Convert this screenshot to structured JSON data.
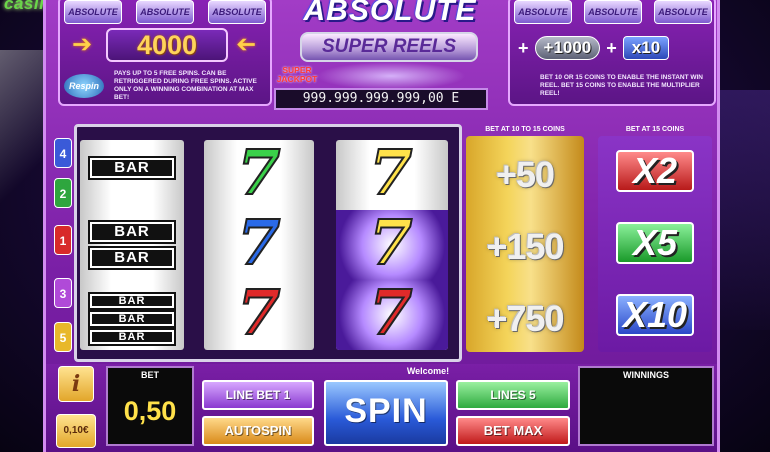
{
  "brand": {
    "text": "casino"
  },
  "top_left": {
    "mini_logos": [
      "ABSOLUTE",
      "ABSOLUTE",
      "ABSOLUTE"
    ],
    "jackpot_value": "4000",
    "respin_logo": "Respin",
    "description": "PAYS UP TO 5 FREE SPINS. CAN BE RETRIGGERED DURING FREE SPINS. ACTIVE ONLY ON A WINNING COMBINATION AT MAX BET!"
  },
  "logo": {
    "title": "ABSOLUTE",
    "subtitle": "SUPER REELS"
  },
  "super_jackpot": {
    "label": "SUPER JACKPOT",
    "value": "999.999.999.999,00 E"
  },
  "top_right": {
    "mini_logos": [
      "ABSOLUTE",
      "ABSOLUTE",
      "ABSOLUTE"
    ],
    "plus": "+",
    "bonus": "+1000",
    "multiplier": "x10",
    "description": "BET 10 OR 15 COINS TO ENABLE THE INSTANT WIN REEL. BET 15 COINS TO ENABLE THE MULTIPLIER REEL!"
  },
  "lines": [
    "4",
    "2",
    "1",
    "3",
    "5"
  ],
  "reels": {
    "reel1": {
      "bar1": "BAR",
      "bar2": "BAR",
      "bar3": "BAR",
      "bar4": "BAR",
      "bar5": "BAR",
      "bar6": "BAR"
    },
    "seven": "7"
  },
  "bonus_reel": {
    "header": "BET AT 10 TO 15 COINS",
    "values": [
      "+50",
      "+150",
      "+750"
    ]
  },
  "multiplier_reel": {
    "header": "BET AT 15 COINS",
    "values": [
      "X2",
      "X5",
      "X10"
    ]
  },
  "controls": {
    "info": "i",
    "coin_value": "0,10€",
    "bet_label": "BET",
    "bet_value": "0,50",
    "welcome": "Welcome!",
    "line_bet": "LINE BET 1",
    "autospin": "AUTOSPIN",
    "spin": "SPIN",
    "lines": "LINES 5",
    "bet_max": "BET MAX",
    "winnings_label": "WINNINGS"
  },
  "colors": {
    "cabinet": "#8a23b6",
    "gold": "#f4d45a",
    "accent": "#ffe14a"
  }
}
